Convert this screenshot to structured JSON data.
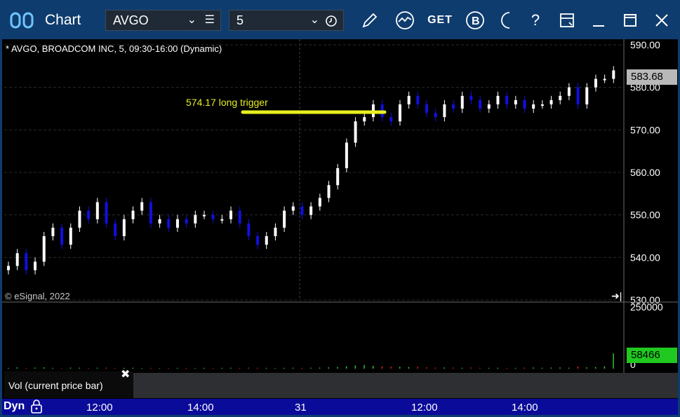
{
  "window": {
    "title": "Chart",
    "symbol": "AVGO",
    "interval": "5"
  },
  "toolbar": {
    "get_label": "GET",
    "help_label": "?",
    "icons": [
      "app-chart-icon",
      "draw-pencil-icon",
      "study-icon",
      "get-icon",
      "b-icon",
      "partial-circle-icon",
      "help-icon",
      "window-layout-icon",
      "minimize-icon",
      "maximize-icon",
      "close-icon"
    ]
  },
  "chart": {
    "legend": "* AVGO, BROADCOM INC, 5, 09:30-16:00 (Dynamic)",
    "copyright": "© eSignal, 2022",
    "trigger_annotation": "574.17 long trigger",
    "last_price": "583.68",
    "price_axis_labels": [
      "590.00",
      "580.00",
      "570.00",
      "560.00",
      "550.00",
      "540.00",
      "530.00"
    ],
    "volume_axis_labels": [
      "250000",
      "0"
    ],
    "last_volume": "58466",
    "volume_panel_label": "Vol (current price bar)",
    "bottom_mode": "Dyn",
    "time_labels": [
      "12:00",
      "14:00",
      "31",
      "12:00",
      "14:00"
    ],
    "colors": {
      "up_bar": "#ffffff",
      "down_bar": "#1010e0",
      "trigger_line": "#e8f020",
      "vol_up": "#2fc02f",
      "vol_down": "#d02020",
      "grid": "#2a2a2a",
      "axis_bar": "#0b0b9a"
    }
  },
  "chart_data": {
    "type": "candlestick",
    "title": "* AVGO, BROADCOM INC, 5, 09:30-16:00 (Dynamic)",
    "ylim": [
      530,
      590
    ],
    "annotation": {
      "label": "574.17 long trigger",
      "value": 574.17
    },
    "last_price": 583.68,
    "last_volume": 58466,
    "close": [
      538,
      541,
      537,
      539,
      545,
      547,
      543,
      547,
      551,
      549,
      553,
      548,
      545,
      549,
      551,
      553,
      548,
      549,
      547,
      549,
      548,
      550,
      550,
      549,
      549,
      551,
      548,
      545,
      543,
      545,
      547,
      551,
      552,
      550,
      552,
      554,
      557,
      561,
      567,
      572,
      573,
      576,
      573,
      572,
      576,
      578,
      576,
      574,
      573,
      576,
      575,
      578,
      577,
      575,
      576,
      578,
      576,
      577,
      575,
      576,
      576,
      577,
      578,
      580,
      576,
      580,
      582,
      582,
      584
    ],
    "volume": [
      3000,
      5000,
      2500,
      4000,
      5000,
      3000,
      2000,
      4000,
      3500,
      2500,
      3500,
      4000,
      3000,
      3000,
      3500,
      2500,
      3000,
      2000,
      2500,
      3000,
      3000,
      2500,
      3000,
      2500,
      3000,
      3500,
      3000,
      4000,
      3500,
      3000,
      2500,
      3000,
      3500,
      3000,
      3500,
      4000,
      5000,
      6000,
      9000,
      12000,
      14000,
      11000,
      9000,
      8000,
      7000,
      6000,
      7000,
      5000,
      4000,
      4500,
      4000,
      3500,
      4500,
      3500,
      3000,
      3500,
      3000,
      3000,
      4000,
      4500,
      3500,
      4000,
      4500,
      3500,
      8000,
      5000,
      6000,
      9000,
      58466
    ]
  }
}
